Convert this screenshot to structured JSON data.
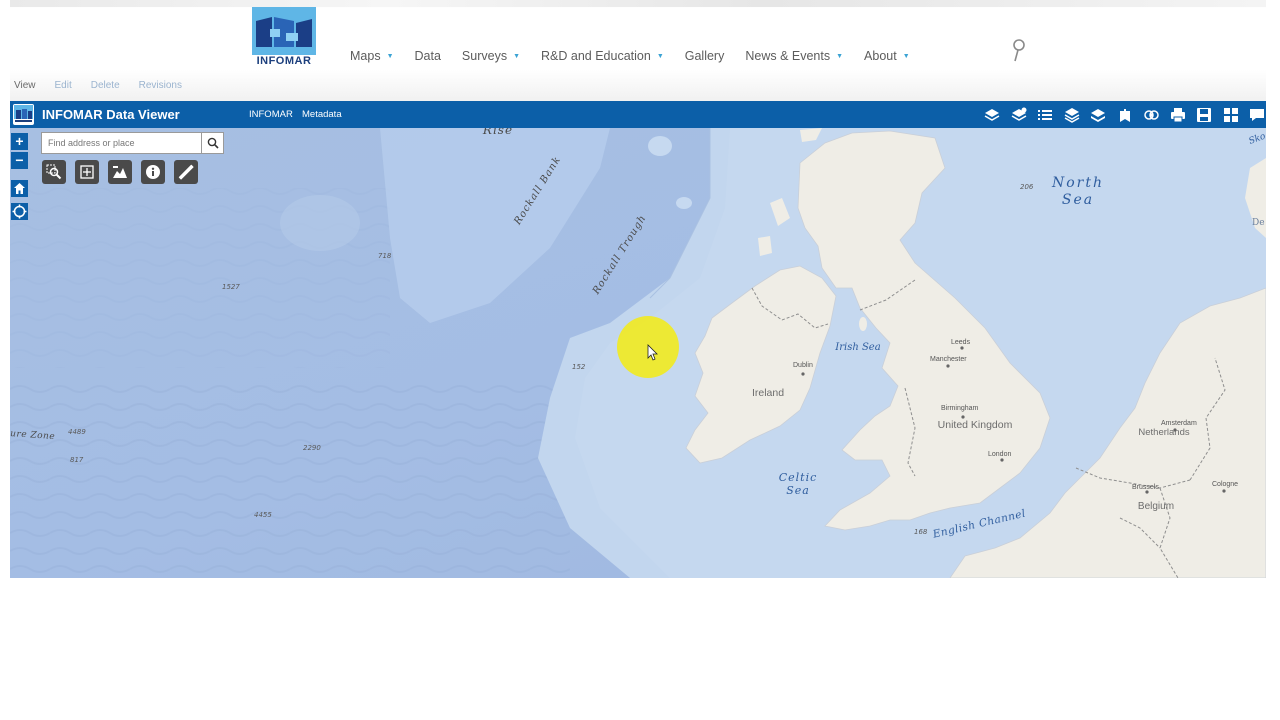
{
  "site": {
    "logo_text": "INFOMAR",
    "nav": [
      {
        "label": "Maps",
        "dropdown": true
      },
      {
        "label": "Data",
        "dropdown": false
      },
      {
        "label": "Surveys",
        "dropdown": true
      },
      {
        "label": "R&D and Education",
        "dropdown": true
      },
      {
        "label": "Gallery",
        "dropdown": false
      },
      {
        "label": "News & Events",
        "dropdown": true
      },
      {
        "label": "About",
        "dropdown": true
      }
    ],
    "search_icon": "search-icon",
    "admin_tabs": [
      "View",
      "Edit",
      "Delete",
      "Revisions"
    ],
    "active_admin_tab": "View"
  },
  "viewer": {
    "title": "INFOMAR Data Viewer",
    "links": [
      "INFOMAR",
      "Metadata"
    ],
    "toolbar_icons": [
      "layers-icon",
      "layers-add-icon",
      "legend-list-icon",
      "layer-list-icon",
      "basemap-gallery-icon",
      "bookmark-icon",
      "analysis-icon",
      "print-icon",
      "save-icon",
      "grid-icon",
      "chat-icon"
    ],
    "zoom_in": "+",
    "zoom_out": "−",
    "search_placeholder": "Find address or place",
    "map_tools": [
      "zoom-area-icon",
      "extent-icon",
      "elevation-profile-icon",
      "info-icon",
      "measure-icon"
    ]
  },
  "map": {
    "water_labels": {
      "rise": "Rise",
      "rockall_bank": "Rockall Bank",
      "rockall_trough": "Rockall Trough",
      "north_sea_1": "North",
      "north_sea_2": "Sea",
      "irish_sea": "Irish Sea",
      "celtic_sea_1": "Celtic",
      "celtic_sea_2": "Sea",
      "english_channel": "English Channel",
      "fracture_zone": "ure Zone",
      "edge_sko": "Sko",
      "edge_de": "De"
    },
    "depths": [
      "718",
      "1527",
      "152",
      "4489",
      "817",
      "2290",
      "4455",
      "206",
      "168"
    ],
    "countries": {
      "ireland": "Ireland",
      "uk": "United Kingdom",
      "netherlands": "Netherlands",
      "belgium": "Belgium"
    },
    "cities": {
      "dublin": "Dublin",
      "leeds": "Leeds",
      "manchester": "Manchester",
      "birmingham": "Birmingham",
      "london": "London",
      "amsterdam": "Amsterdam",
      "brussels": "Brussels",
      "cologne": "Cologne"
    },
    "colors": {
      "deep_ocean": "#a7c0e3",
      "shelf": "#c3d8f0",
      "land": "#efede6",
      "viewer_bar": "#0c5fa8",
      "cursor_highlight": "#f2ea1a"
    }
  }
}
